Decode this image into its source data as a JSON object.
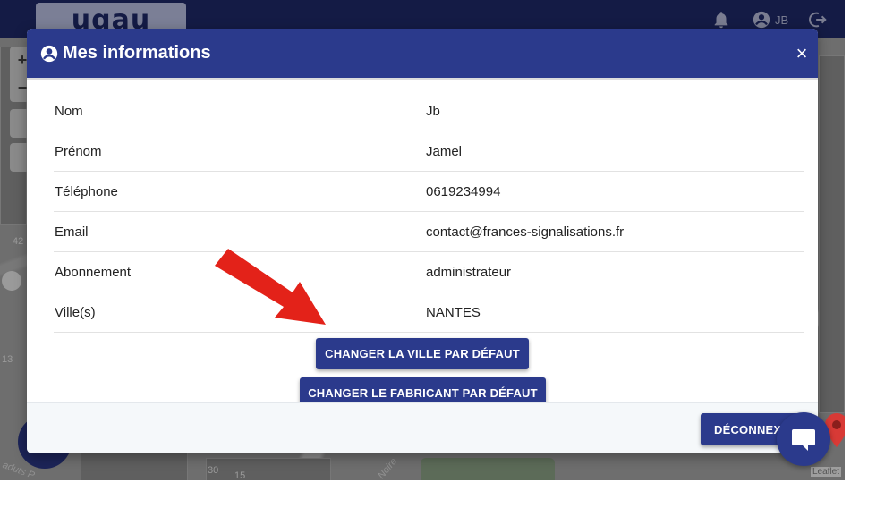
{
  "app": {
    "logo_text": "uqau",
    "user_initials": "JB",
    "map_attribution": "Leaflet"
  },
  "map": {
    "labels": [
      "42",
      "13",
      "30",
      "aduts P",
      "Noire",
      "15"
    ]
  },
  "modal": {
    "title": "Mes informations",
    "close_symbol": "×",
    "rows": [
      {
        "label": "Nom",
        "value": "Jb"
      },
      {
        "label": "Prénom",
        "value": "Jamel"
      },
      {
        "label": "Téléphone",
        "value": "0619234994"
      },
      {
        "label": "Email",
        "value": "contact@frances-signalisations.fr"
      },
      {
        "label": "Abonnement",
        "value": "administrateur"
      },
      {
        "label": "Ville(s)",
        "value": "NANTES"
      }
    ],
    "change_city_label": "CHANGER LA VILLE PAR DÉFAUT",
    "change_maker_label": "CHANGER LE FABRICANT PAR DÉFAUT",
    "logout_label": "DÉCONNEXION"
  },
  "icons": {
    "title": "user-circle-icon",
    "bell": "bell-icon",
    "account": "account-circle-icon",
    "logout": "logout-icon",
    "chat": "chat-bubble-icon",
    "arrow": "red-arrow-annotation-icon",
    "pin": "map-pin-icon"
  },
  "colors": {
    "primary": "#2b3a8c",
    "topbar": "#141b45",
    "arrow": "#e32219",
    "pin": "#d83a36"
  }
}
